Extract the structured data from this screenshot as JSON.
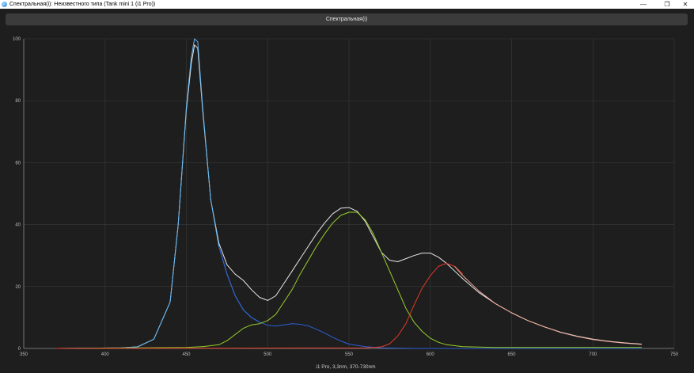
{
  "window": {
    "title": "Спектральная(i): Неизвестного типа (Tank mini 1 (i1 Pro))",
    "minimize_glyph": "—",
    "maximize_glyph": "❐",
    "close_glyph": "✕"
  },
  "tab": {
    "label": "Спектральная(i)"
  },
  "chart_data": {
    "type": "line",
    "title": "",
    "xlabel": "i1 Pro, 3,3nm, 370-730nm",
    "ylabel": "",
    "xlim": [
      350,
      750
    ],
    "ylim": [
      0,
      100
    ],
    "xticks": [
      350,
      400,
      450,
      500,
      550,
      600,
      650,
      700,
      750
    ],
    "yticks": [
      0,
      20,
      40,
      60,
      80,
      100
    ],
    "grid": true,
    "colors": {
      "background": "#1e1e1e",
      "grid": "#3a3a3a",
      "axis": "#888888",
      "tick_label": "#bbbbbb",
      "white": "#e8e8e8",
      "light_blue": "#5fb4f0",
      "blue": "#2b5fd6",
      "green": "#98d02a",
      "red": "#e03a28",
      "salmon": "#f0a898"
    },
    "series": [
      {
        "color_key": "white",
        "points": [
          [
            370,
            0
          ],
          [
            410,
            0.2
          ],
          [
            420,
            0.5
          ],
          [
            430,
            3
          ],
          [
            440,
            15
          ],
          [
            445,
            40
          ],
          [
            450,
            77
          ],
          [
            453,
            92
          ],
          [
            455,
            98
          ],
          [
            457,
            97
          ],
          [
            460,
            77
          ],
          [
            465,
            48
          ],
          [
            470,
            34
          ],
          [
            475,
            27
          ],
          [
            480,
            24
          ],
          [
            485,
            22
          ],
          [
            490,
            19
          ],
          [
            495,
            16.5
          ],
          [
            500,
            15.5
          ],
          [
            505,
            17
          ],
          [
            510,
            21
          ],
          [
            515,
            25
          ],
          [
            520,
            29
          ],
          [
            525,
            33
          ],
          [
            530,
            37
          ],
          [
            535,
            40.5
          ],
          [
            540,
            43.5
          ],
          [
            545,
            45.3
          ],
          [
            550,
            45.5
          ],
          [
            555,
            44.3
          ],
          [
            560,
            41
          ],
          [
            565,
            36
          ],
          [
            570,
            31
          ],
          [
            575,
            28.5
          ],
          [
            580,
            28
          ],
          [
            585,
            29
          ],
          [
            590,
            30
          ],
          [
            595,
            30.8
          ],
          [
            600,
            30.8
          ],
          [
            605,
            29.5
          ],
          [
            610,
            27.5
          ],
          [
            615,
            25
          ],
          [
            620,
            22.5
          ],
          [
            630,
            18
          ],
          [
            640,
            14.5
          ],
          [
            650,
            11.5
          ],
          [
            660,
            9
          ],
          [
            670,
            7
          ],
          [
            680,
            5.3
          ],
          [
            690,
            4
          ],
          [
            700,
            3
          ],
          [
            710,
            2.3
          ],
          [
            720,
            1.8
          ],
          [
            730,
            1.4
          ]
        ]
      },
      {
        "color_key": "light_blue",
        "points": [
          [
            370,
            0
          ],
          [
            410,
            0.2
          ],
          [
            420,
            0.5
          ],
          [
            430,
            3
          ],
          [
            440,
            15
          ],
          [
            445,
            40
          ],
          [
            450,
            78
          ],
          [
            453,
            94
          ],
          [
            455,
            100
          ],
          [
            457,
            99
          ],
          [
            460,
            78
          ],
          [
            465,
            48
          ],
          [
            470,
            33
          ],
          [
            475,
            24
          ],
          [
            480,
            17
          ],
          [
            485,
            12.5
          ],
          [
            490,
            10
          ],
          [
            495,
            8.5
          ]
        ]
      },
      {
        "color_key": "blue",
        "points": [
          [
            470,
            33
          ],
          [
            475,
            24
          ],
          [
            480,
            17
          ],
          [
            485,
            12.5
          ],
          [
            490,
            10
          ],
          [
            495,
            8.5
          ],
          [
            500,
            7.5
          ],
          [
            505,
            7.2
          ],
          [
            510,
            7.6
          ],
          [
            515,
            8
          ],
          [
            520,
            7.8
          ],
          [
            525,
            7.3
          ],
          [
            530,
            6.2
          ],
          [
            535,
            5
          ],
          [
            540,
            3.6
          ],
          [
            545,
            2.4
          ],
          [
            550,
            1.4
          ],
          [
            560,
            0.6
          ],
          [
            570,
            0.2
          ],
          [
            590,
            0
          ],
          [
            730,
            0
          ]
        ]
      },
      {
        "color_key": "green",
        "points": [
          [
            370,
            0
          ],
          [
            450,
            0.3
          ],
          [
            460,
            0.6
          ],
          [
            470,
            1.2
          ],
          [
            475,
            2.5
          ],
          [
            480,
            4.5
          ],
          [
            485,
            6.5
          ],
          [
            490,
            7.6
          ],
          [
            495,
            8
          ],
          [
            500,
            9
          ],
          [
            505,
            11
          ],
          [
            510,
            15
          ],
          [
            515,
            19
          ],
          [
            520,
            24
          ],
          [
            525,
            28.5
          ],
          [
            530,
            33
          ],
          [
            535,
            37
          ],
          [
            540,
            40.5
          ],
          [
            545,
            43
          ],
          [
            550,
            44
          ],
          [
            555,
            44
          ],
          [
            560,
            41.5
          ],
          [
            565,
            37
          ],
          [
            570,
            31
          ],
          [
            575,
            25
          ],
          [
            580,
            19
          ],
          [
            585,
            13
          ],
          [
            590,
            8.5
          ],
          [
            595,
            5.5
          ],
          [
            600,
            3.3
          ],
          [
            605,
            2
          ],
          [
            610,
            1.2
          ],
          [
            620,
            0.6
          ],
          [
            640,
            0.3
          ],
          [
            680,
            0.3
          ],
          [
            730,
            0.3
          ]
        ]
      },
      {
        "color_key": "red",
        "points": [
          [
            370,
            0
          ],
          [
            560,
            0.2
          ],
          [
            570,
            0.5
          ],
          [
            575,
            1.5
          ],
          [
            580,
            4
          ],
          [
            585,
            8
          ],
          [
            590,
            14
          ],
          [
            595,
            19.5
          ],
          [
            600,
            23.5
          ],
          [
            605,
            26.5
          ],
          [
            610,
            27.5
          ],
          [
            615,
            26.5
          ],
          [
            620,
            24
          ]
        ]
      },
      {
        "color_key": "salmon",
        "points": [
          [
            615,
            26.5
          ],
          [
            620,
            23.5
          ],
          [
            630,
            18.5
          ],
          [
            640,
            14.5
          ],
          [
            650,
            11.5
          ],
          [
            660,
            9
          ],
          [
            670,
            7
          ],
          [
            680,
            5.2
          ],
          [
            690,
            3.9
          ],
          [
            700,
            2.9
          ],
          [
            710,
            2.2
          ],
          [
            720,
            1.7
          ],
          [
            730,
            1.3
          ]
        ]
      }
    ]
  }
}
